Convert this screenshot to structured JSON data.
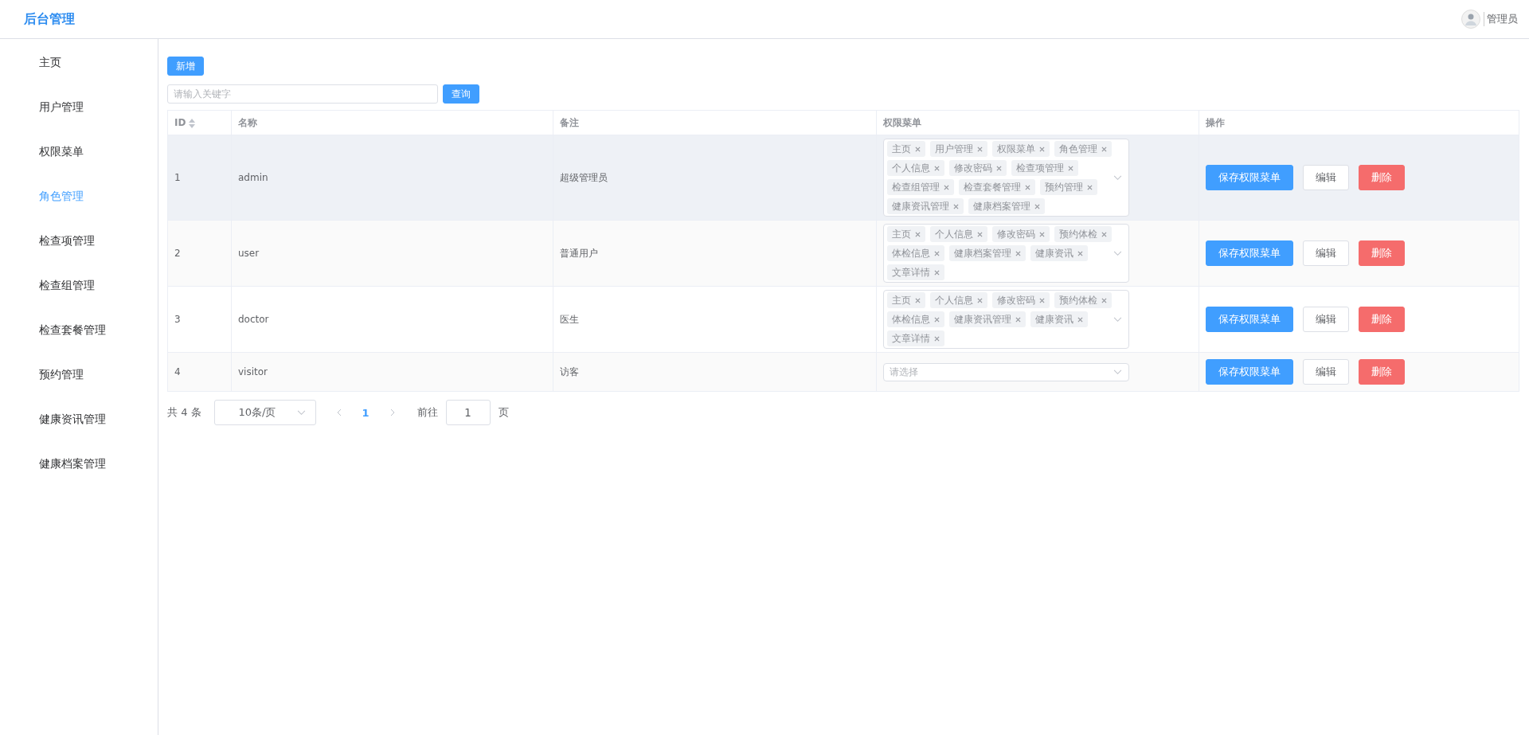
{
  "header": {
    "title": "后台管理",
    "user": "管理员"
  },
  "sidebar": {
    "items": [
      {
        "label": "主页",
        "selected": false
      },
      {
        "label": "用户管理",
        "selected": false
      },
      {
        "label": "权限菜单",
        "selected": false
      },
      {
        "label": "角色管理",
        "selected": true
      },
      {
        "label": "检查项管理",
        "selected": false
      },
      {
        "label": "检查组管理",
        "selected": false
      },
      {
        "label": "检查套餐管理",
        "selected": false
      },
      {
        "label": "预约管理",
        "selected": false
      },
      {
        "label": "健康资讯管理",
        "selected": false
      },
      {
        "label": "健康档案管理",
        "selected": false
      }
    ]
  },
  "toolbar": {
    "add_button": "新增",
    "search": {
      "placeholder": "请输入关键字"
    },
    "search_button": "查询"
  },
  "table": {
    "columns": [
      "ID",
      "名称",
      "备注",
      "权限菜单",
      "操作"
    ],
    "rows": [
      {
        "id": "1",
        "name": "admin",
        "remark": "超级管理员",
        "hovered": true,
        "menus": [
          "主页",
          "用户管理",
          "权限菜单",
          "角色管理",
          "个人信息",
          "修改密码",
          "检查项管理",
          "检查组管理",
          "检查套餐管理",
          "预约管理",
          "健康资讯管理",
          "健康档案管理"
        ],
        "actions": [
          "保存权限菜单",
          "编辑",
          "删除"
        ]
      },
      {
        "id": "2",
        "name": "user",
        "remark": "普通用户",
        "hovered": false,
        "menus": [
          "主页",
          "个人信息",
          "修改密码",
          "预约体检",
          "体检信息",
          "健康档案管理",
          "健康资讯",
          "文章详情"
        ],
        "actions": [
          "保存权限菜单",
          "编辑",
          "删除"
        ]
      },
      {
        "id": "3",
        "name": "doctor",
        "remark": "医生",
        "hovered": false,
        "menus": [
          "主页",
          "个人信息",
          "修改密码",
          "预约体检",
          "体检信息",
          "健康资讯管理",
          "健康资讯",
          "文章详情"
        ],
        "actions": [
          "保存权限菜单",
          "编辑",
          "删除"
        ]
      },
      {
        "id": "4",
        "name": "visitor",
        "remark": "访客",
        "hovered": false,
        "menus": [],
        "placeholder": "请选择",
        "actions": [
          "保存权限菜单",
          "编辑",
          "删除"
        ]
      }
    ]
  },
  "pagination": {
    "total": "共 4 条",
    "page_size": "10条/页",
    "pages": [
      {
        "label": "1",
        "selected": true
      }
    ],
    "goto_label": "前往",
    "goto_value": "1",
    "goto_suffix": "页"
  }
}
